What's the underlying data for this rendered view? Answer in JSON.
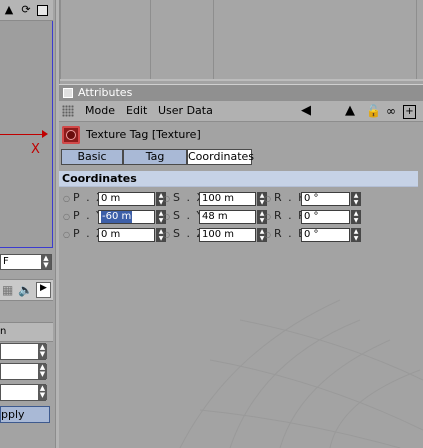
{
  "left_toolbar": {
    "icons": [
      "letter-a-icon",
      "rotate-icon",
      "window-icon"
    ]
  },
  "left_viewport": {
    "axis_label": "X",
    "colors": {
      "axis": "#c00000",
      "frame": "#3b3bd0"
    }
  },
  "left_field": {
    "value": "F"
  },
  "left_panel": {
    "header": "n",
    "apply_label": "pply"
  },
  "attributes": {
    "title": "Attributes",
    "menu": [
      "Mode",
      "Edit",
      "User Data"
    ],
    "toolbar_icons": [
      "back-arrow-icon",
      "up-arrow-icon",
      "lock-icon",
      "link-icon",
      "new-panel-icon"
    ],
    "tag_title": "Texture Tag [Texture]",
    "tabs": [
      "Basic",
      "Tag",
      "Coordinates"
    ],
    "active_tab": "Coordinates",
    "section_title": "Coordinates",
    "coords": {
      "p": [
        {
          "label": "P . X",
          "value": "0 m"
        },
        {
          "label": "P . Y",
          "value": "-60 m"
        },
        {
          "label": "P . Z",
          "value": "0 m"
        }
      ],
      "s": [
        {
          "label": "S . X",
          "value": "100 m"
        },
        {
          "label": "S . Y",
          "value": "48 m"
        },
        {
          "label": "S . Z",
          "value": "100 m"
        }
      ],
      "r": [
        {
          "label": "R . H",
          "value": "0 °"
        },
        {
          "label": "R . P",
          "value": "0 °"
        },
        {
          "label": "R . B",
          "value": "0 °"
        }
      ]
    }
  },
  "colors": {
    "accent": "#3d5fa8",
    "section_bar": "#c6d2e6",
    "active_tab": "#ffffff",
    "tab": "#a9b9d6"
  }
}
